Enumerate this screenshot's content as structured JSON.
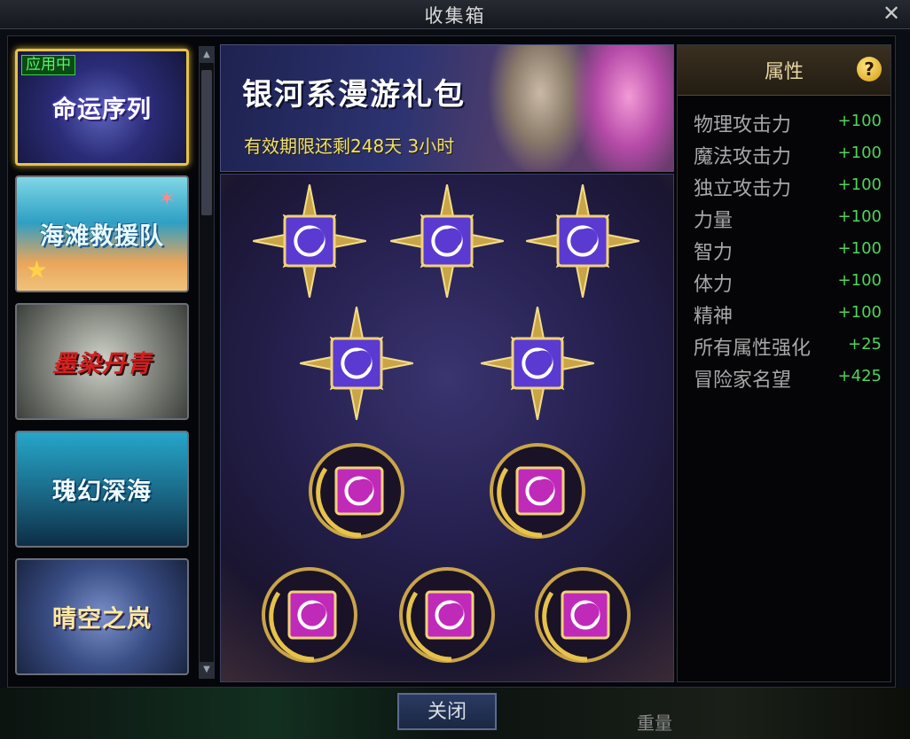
{
  "window": {
    "title": "收集箱",
    "close_icon": "close-icon"
  },
  "sidebar": {
    "active_badge": "应用中",
    "items": [
      {
        "label": "命运序列",
        "active": true
      },
      {
        "label": "海滩救援队",
        "active": false
      },
      {
        "label": "墨染丹青",
        "active": false
      },
      {
        "label": "瑰幻深海",
        "active": false
      },
      {
        "label": "晴空之岚",
        "active": false
      }
    ]
  },
  "banner": {
    "title": "银河系漫游礼包",
    "expiry": "有效期限还剩248天 3小时"
  },
  "collection": {
    "items": [
      {
        "type": "star",
        "color": "purple"
      },
      {
        "type": "star",
        "color": "purple"
      },
      {
        "type": "star",
        "color": "purple"
      },
      {
        "type": "star",
        "color": "purple"
      },
      {
        "type": "star",
        "color": "purple"
      },
      {
        "type": "moon",
        "color": "magenta"
      },
      {
        "type": "moon",
        "color": "magenta"
      },
      {
        "type": "moon",
        "color": "magenta"
      },
      {
        "type": "moon",
        "color": "magenta"
      },
      {
        "type": "moon",
        "color": "magenta"
      }
    ]
  },
  "properties": {
    "title": "属性",
    "help": "?",
    "rows": [
      {
        "name": "物理攻击力",
        "value": "+100"
      },
      {
        "name": "魔法攻击力",
        "value": "+100"
      },
      {
        "name": "独立攻击力",
        "value": "+100"
      },
      {
        "name": "力量",
        "value": "+100"
      },
      {
        "name": "智力",
        "value": "+100"
      },
      {
        "name": "体力",
        "value": "+100"
      },
      {
        "name": "精神",
        "value": "+100"
      },
      {
        "name": "所有属性强化",
        "value": "+25"
      },
      {
        "name": "冒险家名望",
        "value": "+425"
      }
    ]
  },
  "footer": {
    "close_label": "关闭",
    "weight_label": "重量"
  },
  "colors": {
    "accent_gold": "#e6c34a",
    "badge_green": "#3fd24c",
    "value_green": "#4fd45c"
  }
}
